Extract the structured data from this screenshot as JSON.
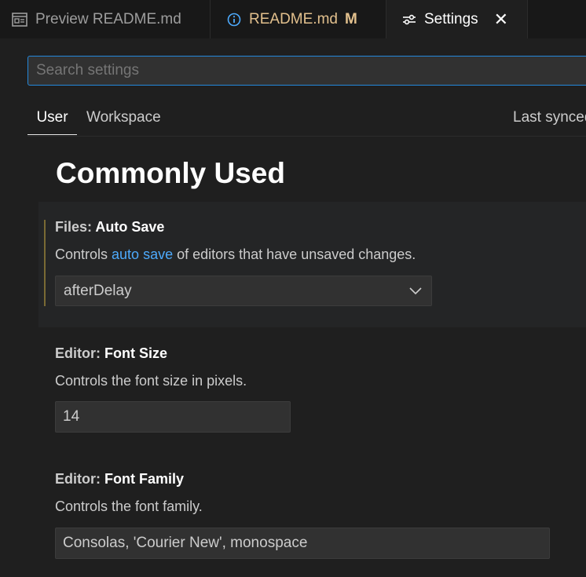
{
  "tabs": [
    {
      "label": "Preview README.md",
      "icon": "preview-icon"
    },
    {
      "label": "README.md",
      "icon": "info-icon",
      "badge": "M"
    },
    {
      "label": "Settings",
      "icon": "settings-sliders-icon",
      "close": "✕"
    }
  ],
  "search": {
    "placeholder": "Search settings"
  },
  "scopes": {
    "user": "User",
    "workspace": "Workspace",
    "last_synced": "Last synced"
  },
  "section": {
    "title": "Commonly Used"
  },
  "settings": [
    {
      "category": "Files: ",
      "name": "Auto Save",
      "desc_before": "Controls ",
      "desc_link": "auto save",
      "desc_after": " of editors that have unsaved changes.",
      "value": "afterDelay",
      "control": "select"
    },
    {
      "category": "Editor: ",
      "name": "Font Size",
      "desc": "Controls the font size in pixels.",
      "value": "14",
      "control": "text"
    },
    {
      "category": "Editor: ",
      "name": "Font Family",
      "desc": "Controls the font family.",
      "value": "Consolas, 'Courier New', monospace",
      "control": "text"
    }
  ],
  "colors": {
    "accent": "#2488db",
    "modified": "#e2c08d",
    "link": "#4daafc",
    "focus_bar": "#7a6a34"
  }
}
